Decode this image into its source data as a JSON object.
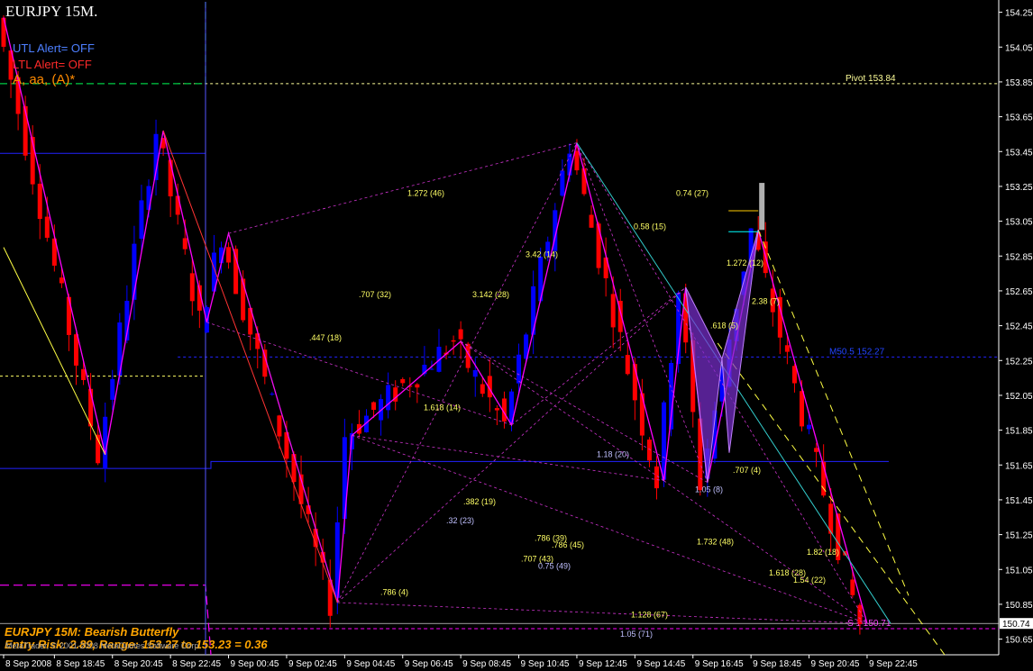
{
  "header": {
    "title": "EURJPY 15M.",
    "utl_alert": "UTL Alert= OFF",
    "ltl_alert": "LTL Alert= OFF",
    "wave_label": "A, aa, (A)*"
  },
  "footer": {
    "pattern": "EURJPY 15M: Bearish Butterfly",
    "entry": "Entry Risk: 2.89, Range: 153.27 to 153.23 = 0.36",
    "copyright": "MetaTrader, © 2001-2008 MetaQuotes Software Corp."
  },
  "colors": {
    "background": "#000000",
    "bull_candle": "#0000ff",
    "bear_candle": "#ff0000",
    "grid_text": "#ffffff",
    "fib_label": "#ffff66",
    "pattern_fill": "#7b2fd0",
    "zigzag": "#ff00ff",
    "pivot": "#ffffcc"
  },
  "chart_data": {
    "type": "candlestick",
    "symbol": "EURJPY",
    "timeframe": "15M",
    "ylim": [
      150.56,
      154.31
    ],
    "y_ticks": [
      "154.25",
      "154.05",
      "153.85",
      "153.65",
      "153.45",
      "153.25",
      "153.05",
      "152.85",
      "152.65",
      "152.45",
      "152.25",
      "152.05",
      "151.85",
      "151.65",
      "151.45",
      "151.25",
      "151.05",
      "150.85",
      "150.65"
    ],
    "current_price": "150.74",
    "x_ticks": [
      "8 Sep 2008",
      "8 Sep 18:45",
      "8 Sep 20:45",
      "8 Sep 22:45",
      "9 Sep 00:45",
      "9 Sep 02:45",
      "9 Sep 04:45",
      "9 Sep 06:45",
      "9 Sep 08:45",
      "9 Sep 10:45",
      "9 Sep 12:45",
      "9 Sep 14:45",
      "9 Sep 16:45",
      "9 Sep 18:45",
      "9 Sep 20:45",
      "9 Sep 22:45"
    ],
    "levels": [
      {
        "name": "Pivot",
        "text": "Pivot   153.84",
        "price": 153.84
      },
      {
        "name": "M50.5",
        "text": "M50.5   152.27",
        "price": 152.27
      },
      {
        "name": "S1",
        "text": "S 1   150.71",
        "price": 150.71
      }
    ],
    "fib_labels": [
      {
        "text": "1.272 (46)",
        "price": 153.21
      },
      {
        "text": "0.74 (27)",
        "price": 153.21
      },
      {
        "text": "0.58 (15)",
        "price": 153.02
      },
      {
        "text": "3.42 (14)",
        "price": 152.86
      },
      {
        "text": "1.272 (12)",
        "price": 152.81
      },
      {
        "text": ".707 (32)",
        "price": 152.63
      },
      {
        "text": "3.142 (28)",
        "price": 152.63
      },
      {
        "text": "2.38 (7)",
        "price": 152.59
      },
      {
        "text": ".618 (5)",
        "price": 152.45
      },
      {
        "text": ".447 (18)",
        "price": 152.38
      },
      {
        "text": "1.618 (14)",
        "price": 151.98
      },
      {
        "text": "1.18 (20)",
        "price": 151.71
      },
      {
        "text": ".707 (4)",
        "price": 151.62
      },
      {
        "text": "1.05 (8)",
        "price": 151.51
      },
      {
        "text": ".382 (19)",
        "price": 151.44
      },
      {
        "text": ".32 (23)",
        "price": 151.33
      },
      {
        "text": ".786 (39)",
        "price": 151.23
      },
      {
        "text": "1.732 (48)",
        "price": 151.21
      },
      {
        "text": ".786 (45)",
        "price": 151.19
      },
      {
        "text": "1.82 (18)",
        "price": 151.15
      },
      {
        "text": ".707 (43)",
        "price": 151.11
      },
      {
        "text": "0.75 (49)",
        "price": 151.07
      },
      {
        "text": "1.618 (28)",
        "price": 151.03
      },
      {
        "text": "1.54 (22)",
        "price": 150.99
      },
      {
        "text": ".786 (4)",
        "price": 150.92
      },
      {
        "text": "1.128 (67)",
        "price": 150.79
      },
      {
        "text": "1.05 (71)",
        "price": 150.68
      }
    ],
    "zigzag": [
      {
        "time": "8 Sep 2008",
        "price": 154.22
      },
      {
        "time": "8 Sep 20:30",
        "price": 151.71
      },
      {
        "time": "8 Sep 22:30",
        "price": 153.57
      },
      {
        "time": "9 Sep 00:00",
        "price": 152.47
      },
      {
        "time": "9 Sep 00:45",
        "price": 152.98
      },
      {
        "time": "9 Sep 04:30",
        "price": 150.86
      },
      {
        "time": "9 Sep 05:00",
        "price": 151.82
      },
      {
        "time": "9 Sep 08:45",
        "price": 152.36
      },
      {
        "time": "9 Sep 10:30",
        "price": 151.88
      },
      {
        "time": "9 Sep 12:45",
        "price": 153.5
      },
      {
        "time": "9 Sep 15:45",
        "price": 151.56
      },
      {
        "time": "9 Sep 16:30",
        "price": 152.67
      },
      {
        "time": "9 Sep 17:15",
        "price": 151.55
      },
      {
        "time": "9 Sep 19:00",
        "price": 153.0
      },
      {
        "time": "9 Sep 22:45",
        "price": 150.74
      }
    ],
    "butterfly": {
      "X": 152.67,
      "A": 151.55,
      "B": 152.26,
      "C": 151.72,
      "D": 153.0
    }
  }
}
